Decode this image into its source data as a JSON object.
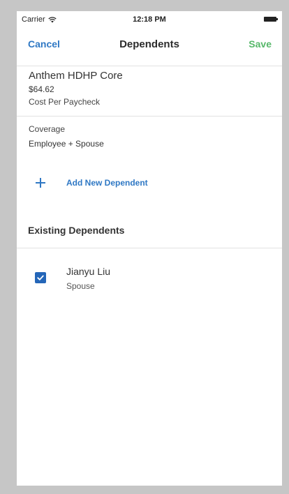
{
  "status_bar": {
    "carrier": "Carrier",
    "time": "12:18 PM",
    "wifi_icon": "wifi-icon",
    "battery_icon": "battery-icon"
  },
  "nav": {
    "cancel_label": "Cancel",
    "title": "Dependents",
    "save_label": "Save"
  },
  "plan": {
    "name": "Anthem HDHP Core",
    "cost": "$64.62",
    "cost_label": "Cost Per Paycheck"
  },
  "coverage": {
    "label": "Coverage",
    "value": "Employee + Spouse"
  },
  "add_dependent": {
    "icon": "plus-icon",
    "label": "Add New Dependent"
  },
  "existing": {
    "section_title": "Existing Dependents",
    "dependents": [
      {
        "name": "Jianyu Liu",
        "relationship": "Spouse",
        "selected": true
      }
    ]
  },
  "colors": {
    "accent_blue": "#2f78c4",
    "save_green": "#57b86a",
    "checkbox_blue": "#2466b8",
    "frame_gray": "#c6c6c6"
  }
}
